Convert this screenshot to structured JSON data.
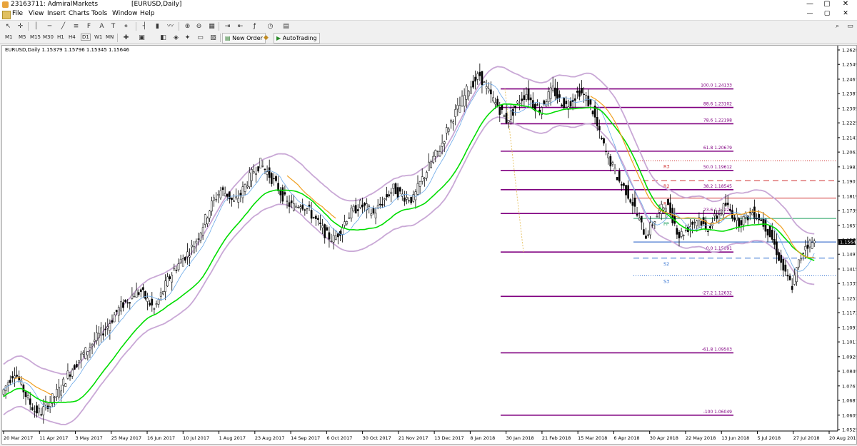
{
  "window": {
    "title": "23163711: AdmiralMarkets",
    "doc_title": "[EURUSD,Daily]",
    "buttons": [
      "—",
      "▢",
      "✕"
    ]
  },
  "menu": [
    "File",
    "View",
    "Insert",
    "Charts",
    "Tools",
    "Window",
    "Help"
  ],
  "toolbar": {
    "timeframes": [
      "M1",
      "M5",
      "M15",
      "M30",
      "H1",
      "H4",
      "D1",
      "W1",
      "MN"
    ],
    "new_order": "New Order",
    "autotrading": "AutoTrading"
  },
  "chart": {
    "header": "EURUSD,Daily  1.15379 1.15796 1.15345 1.15646",
    "current_price": "1.15646",
    "colors": {
      "candle": "#000000",
      "bands": "#c9a8d6",
      "ema_green": "#00dd00",
      "ema_blue": "#6aa8e8",
      "ema_orange": "#f0a020",
      "fib": "#800080",
      "r": "#d03030",
      "pp": "#20a060",
      "s": "#3070d0"
    },
    "price_axis": [
      "1.26290",
      "1.25490",
      "1.24670",
      "1.23870",
      "1.23050",
      "1.22250",
      "1.21430",
      "1.20630",
      "1.19810",
      "1.19010",
      "1.18190",
      "1.17390",
      "1.16570",
      "1.15770",
      "1.14970",
      "1.14150",
      "1.13350",
      "1.12530",
      "1.11730",
      "1.10910",
      "1.10110",
      "1.09290",
      "1.08490",
      "1.07670",
      "1.06870",
      "1.06050",
      "1.05250"
    ],
    "date_axis": [
      "20 Mar 2017",
      "11 Apr 2017",
      "3 May 2017",
      "25 May 2017",
      "16 Jun 2017",
      "10 Jul 2017",
      "1 Aug 2017",
      "23 Aug 2017",
      "14 Sep 2017",
      "6 Oct 2017",
      "30 Oct 2017",
      "21 Nov 2017",
      "13 Dec 2017",
      "8 Jan 2018",
      "30 Jan 2018",
      "21 Feb 2018",
      "15 Mar 2018",
      "6 Apr 2018",
      "30 Apr 2018",
      "22 May 2018",
      "13 Jun 2018",
      "5 Jul 2018",
      "27 Jul 2018",
      "20 Aug 2018"
    ],
    "fib_levels": [
      {
        "label": "100.0 1.24133",
        "price": 1.24133
      },
      {
        "label": "88.6 1.23102",
        "price": 1.23102
      },
      {
        "label": "78.6 1.22198",
        "price": 1.22198
      },
      {
        "label": "61.8 1.20679",
        "price": 1.20679
      },
      {
        "label": "50.0 1.19612",
        "price": 1.19612
      },
      {
        "label": "38.2 1.18545",
        "price": 1.18545
      },
      {
        "label": "23.6 1.17225",
        "price": 1.17225
      },
      {
        "label": "0.0 1.15091",
        "price": 1.15091
      },
      {
        "label": "-27.2 1.12632",
        "price": 1.12632
      },
      {
        "label": "-61.8 1.09503",
        "price": 1.09503
      },
      {
        "label": "-100 1.06049",
        "price": 1.06049
      }
    ],
    "pivots": [
      {
        "label": "R3",
        "price": 1.2015,
        "style": "dotted",
        "color": "r"
      },
      {
        "label": "R2",
        "price": 1.1905,
        "style": "dashed",
        "color": "r"
      },
      {
        "label": "R1",
        "price": 1.1808,
        "style": "solid",
        "color": "r"
      },
      {
        "label": "PP",
        "price": 1.1695,
        "style": "solid",
        "color": "pp"
      },
      {
        "label": "S2",
        "price": 1.1475,
        "style": "dashed",
        "color": "s"
      },
      {
        "label": "S3",
        "price": 1.1378,
        "style": "dotted",
        "color": "s"
      }
    ],
    "price_path": [
      [
        0,
        1.072
      ],
      [
        3,
        1.079
      ],
      [
        6,
        1.085
      ],
      [
        9,
        1.077
      ],
      [
        12,
        1.069
      ],
      [
        15,
        1.063
      ],
      [
        18,
        1.062
      ],
      [
        21,
        1.067
      ],
      [
        24,
        1.071
      ],
      [
        27,
        1.076
      ],
      [
        30,
        1.083
      ],
      [
        33,
        1.088
      ],
      [
        36,
        1.093
      ],
      [
        39,
        1.097
      ],
      [
        42,
        1.102
      ],
      [
        45,
        1.106
      ],
      [
        48,
        1.11
      ],
      [
        51,
        1.116
      ],
      [
        54,
        1.121
      ],
      [
        57,
        1.124
      ],
      [
        60,
        1.128
      ],
      [
        63,
        1.129
      ],
      [
        66,
        1.124
      ],
      [
        69,
        1.119
      ],
      [
        72,
        1.127
      ],
      [
        75,
        1.135
      ],
      [
        78,
        1.141
      ],
      [
        81,
        1.146
      ],
      [
        84,
        1.15
      ],
      [
        87,
        1.155
      ],
      [
        90,
        1.163
      ],
      [
        93,
        1.172
      ],
      [
        96,
        1.18
      ],
      [
        99,
        1.185
      ],
      [
        102,
        1.183
      ],
      [
        105,
        1.178
      ],
      [
        108,
        1.183
      ],
      [
        111,
        1.19
      ],
      [
        114,
        1.196
      ],
      [
        117,
        1.2
      ],
      [
        120,
        1.195
      ],
      [
        123,
        1.19
      ],
      [
        126,
        1.184
      ],
      [
        129,
        1.178
      ],
      [
        132,
        1.176
      ],
      [
        135,
        1.178
      ],
      [
        138,
        1.175
      ],
      [
        141,
        1.17
      ],
      [
        144,
        1.165
      ],
      [
        147,
        1.16
      ],
      [
        150,
        1.158
      ],
      [
        153,
        1.163
      ],
      [
        156,
        1.17
      ],
      [
        159,
        1.174
      ],
      [
        162,
        1.177
      ],
      [
        165,
        1.175
      ],
      [
        168,
        1.172
      ],
      [
        171,
        1.177
      ],
      [
        174,
        1.182
      ],
      [
        177,
        1.186
      ],
      [
        180,
        1.183
      ],
      [
        183,
        1.181
      ],
      [
        186,
        1.18
      ],
      [
        189,
        1.189
      ],
      [
        192,
        1.196
      ],
      [
        195,
        1.203
      ],
      [
        198,
        1.208
      ],
      [
        201,
        1.218
      ],
      [
        204,
        1.226
      ],
      [
        207,
        1.232
      ],
      [
        210,
        1.24
      ],
      [
        213,
        1.245
      ],
      [
        216,
        1.249
      ],
      [
        219,
        1.241
      ],
      [
        222,
        1.235
      ],
      [
        225,
        1.23
      ],
      [
        228,
        1.224
      ],
      [
        231,
        1.229
      ],
      [
        234,
        1.235
      ],
      [
        237,
        1.239
      ],
      [
        240,
        1.233
      ],
      [
        243,
        1.23
      ],
      [
        246,
        1.236
      ],
      [
        249,
        1.241
      ],
      [
        252,
        1.235
      ],
      [
        255,
        1.232
      ],
      [
        258,
        1.236
      ],
      [
        261,
        1.24
      ],
      [
        264,
        1.236
      ],
      [
        267,
        1.229
      ],
      [
        270,
        1.216
      ],
      [
        273,
        1.206
      ],
      [
        276,
        1.198
      ],
      [
        279,
        1.19
      ],
      [
        282,
        1.185
      ],
      [
        285,
        1.178
      ],
      [
        288,
        1.168
      ],
      [
        291,
        1.16
      ],
      [
        294,
        1.167
      ],
      [
        297,
        1.173
      ],
      [
        300,
        1.178
      ],
      [
        303,
        1.17
      ],
      [
        306,
        1.16
      ],
      [
        309,
        1.163
      ],
      [
        312,
        1.167
      ],
      [
        315,
        1.17
      ],
      [
        318,
        1.163
      ],
      [
        321,
        1.168
      ],
      [
        324,
        1.172
      ],
      [
        327,
        1.177
      ],
      [
        330,
        1.172
      ],
      [
        333,
        1.168
      ],
      [
        336,
        1.17
      ],
      [
        339,
        1.173
      ],
      [
        342,
        1.17
      ],
      [
        345,
        1.165
      ],
      [
        348,
        1.158
      ],
      [
        351,
        1.148
      ],
      [
        354,
        1.138
      ],
      [
        357,
        1.132
      ],
      [
        360,
        1.145
      ],
      [
        363,
        1.155
      ],
      [
        366,
        1.156
      ]
    ]
  }
}
